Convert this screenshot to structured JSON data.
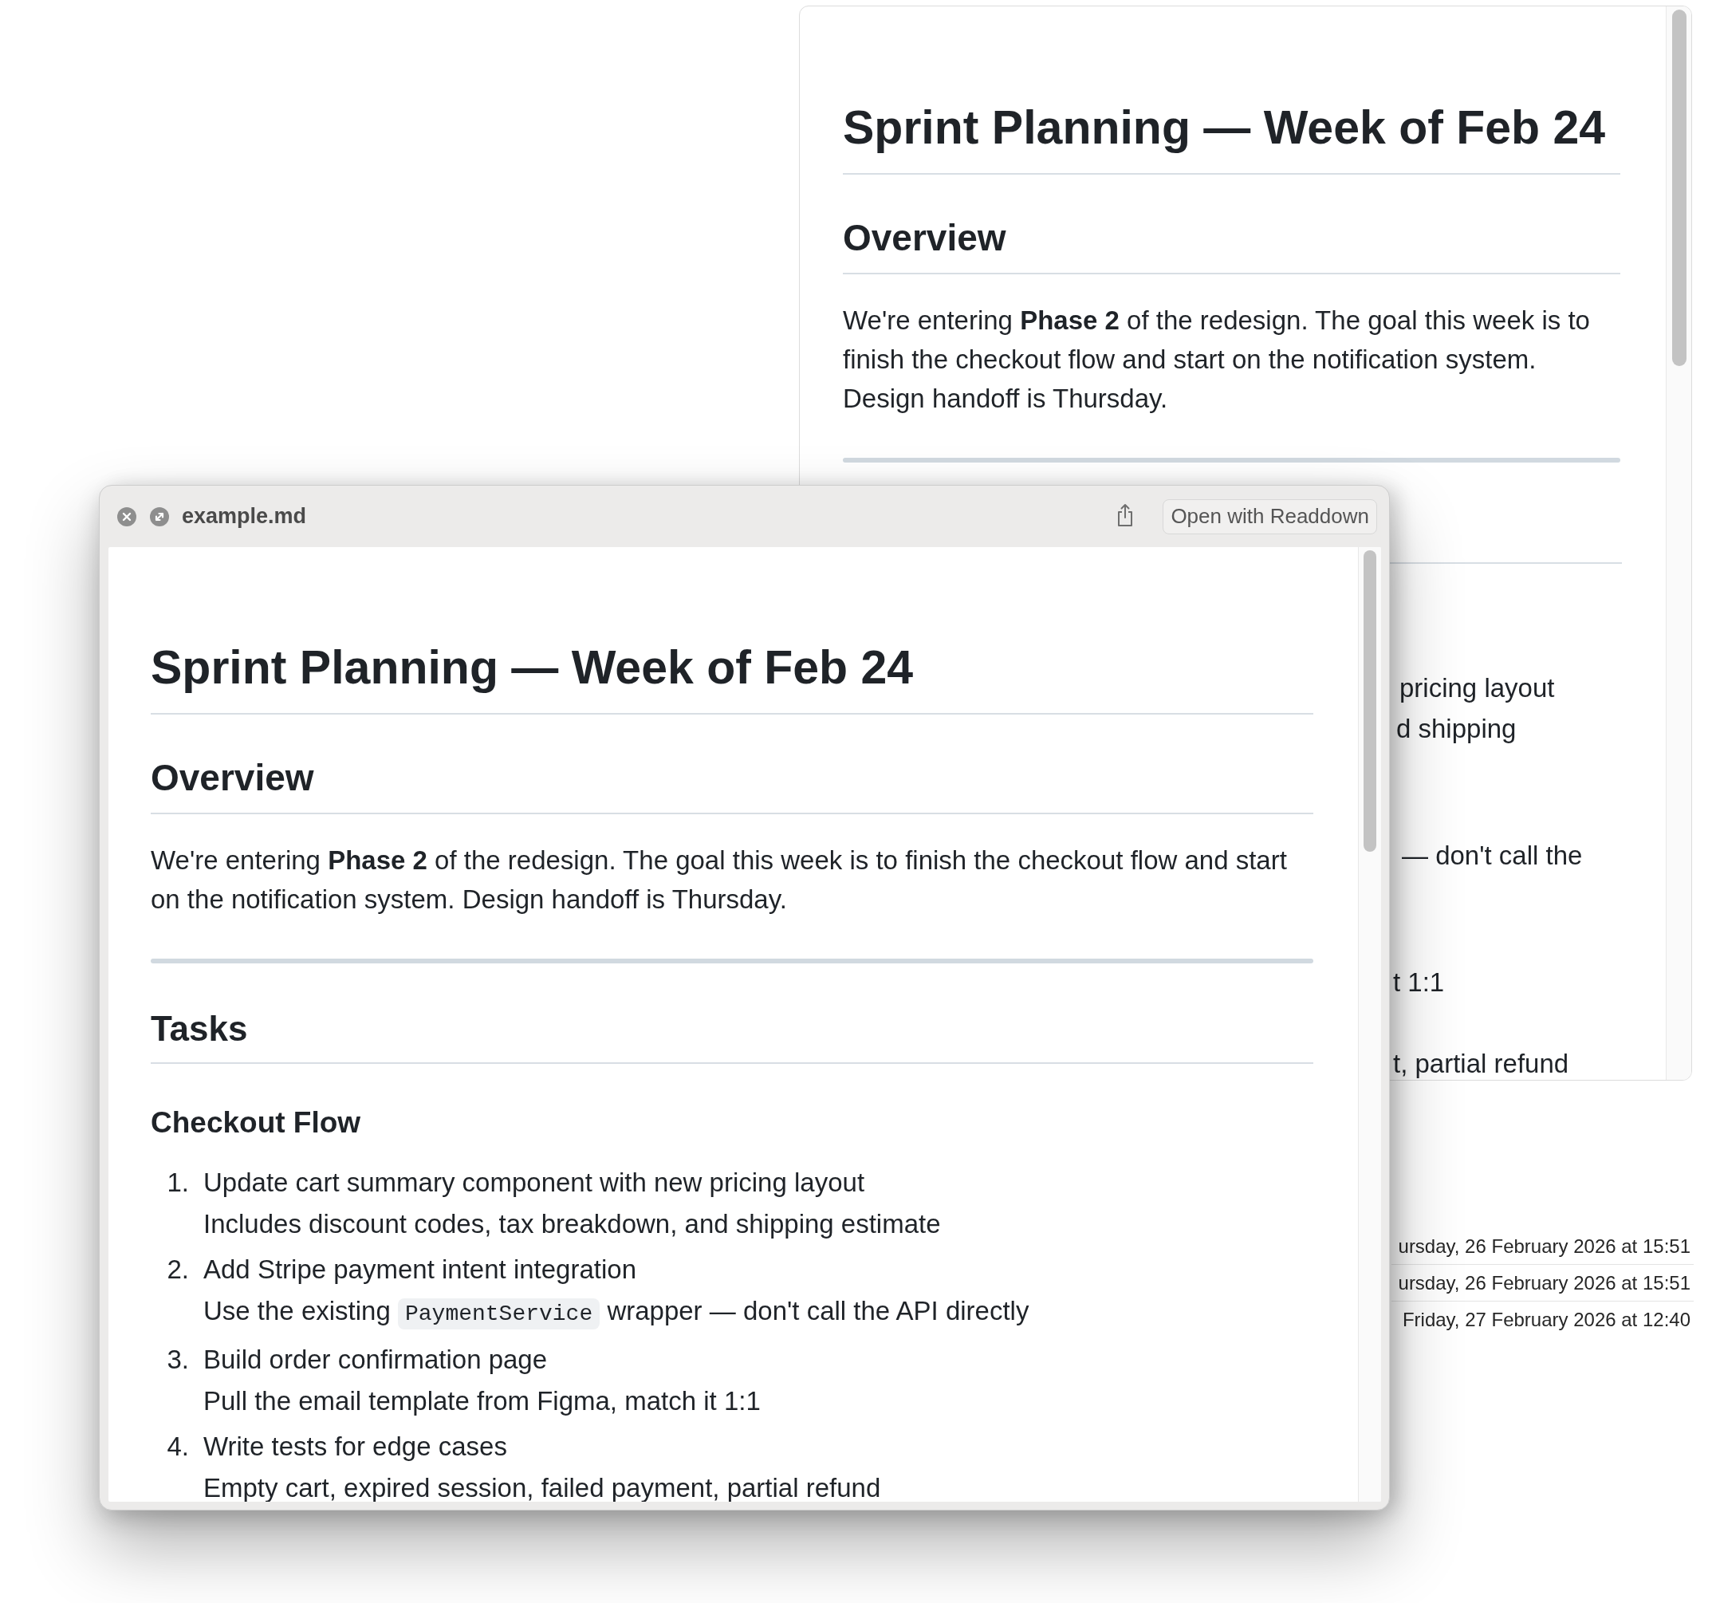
{
  "app_window": {
    "document": {
      "title": "Sprint Planning — Week of Feb 24",
      "overview": {
        "heading": "Overview",
        "paragraph": "We're entering **Phase 2** of the redesign. The goal this week is to finish the checkout flow and start on the notification system. Design handoff is Thursday."
      },
      "cut_off_lines": [
        "pricing layout",
        "d shipping",
        "— don't call the",
        "t 1:1",
        "t, partial refund"
      ]
    }
  },
  "file_dates": [
    "ursday, 26 February 2026 at 15:51",
    "ursday, 26 February 2026 at 15:51",
    "Friday, 27 February 2026 at 12:40"
  ],
  "preview_window": {
    "title": "example.md",
    "open_button": "Open with Readdown",
    "document": {
      "title": "Sprint Planning — Week of Feb 24",
      "overview": {
        "heading": "Overview",
        "paragraph": "We're entering **Phase 2** of the redesign. The goal this week is to finish the checkout flow and start on the notification system. Design handoff is Thursday."
      },
      "tasks": {
        "heading": "Tasks",
        "subsections": [
          {
            "heading": "Checkout Flow",
            "items": [
              {
                "number": "1.",
                "text": "Update cart summary component with new pricing layout",
                "note": [
                  {
                    "kind": "text",
                    "text": "Includes discount codes, tax breakdown, and shipping estimate"
                  }
                ]
              },
              {
                "number": "2.",
                "text": "Add Stripe payment intent integration",
                "note": [
                  {
                    "kind": "text",
                    "text": "Use the existing "
                  },
                  {
                    "kind": "code",
                    "text": "PaymentService"
                  },
                  {
                    "kind": "text",
                    "text": " wrapper — don't call the API directly"
                  }
                ]
              },
              {
                "number": "3.",
                "text": "Build order confirmation page",
                "note": [
                  {
                    "kind": "text",
                    "text": "Pull the email template from Figma, match it 1:1"
                  }
                ]
              },
              {
                "number": "4.",
                "text": "Write tests for edge cases",
                "note": [
                  {
                    "kind": "text",
                    "text": "Empty cart, expired session, failed payment, partial refund"
                  }
                ]
              }
            ]
          }
        ]
      }
    }
  }
}
